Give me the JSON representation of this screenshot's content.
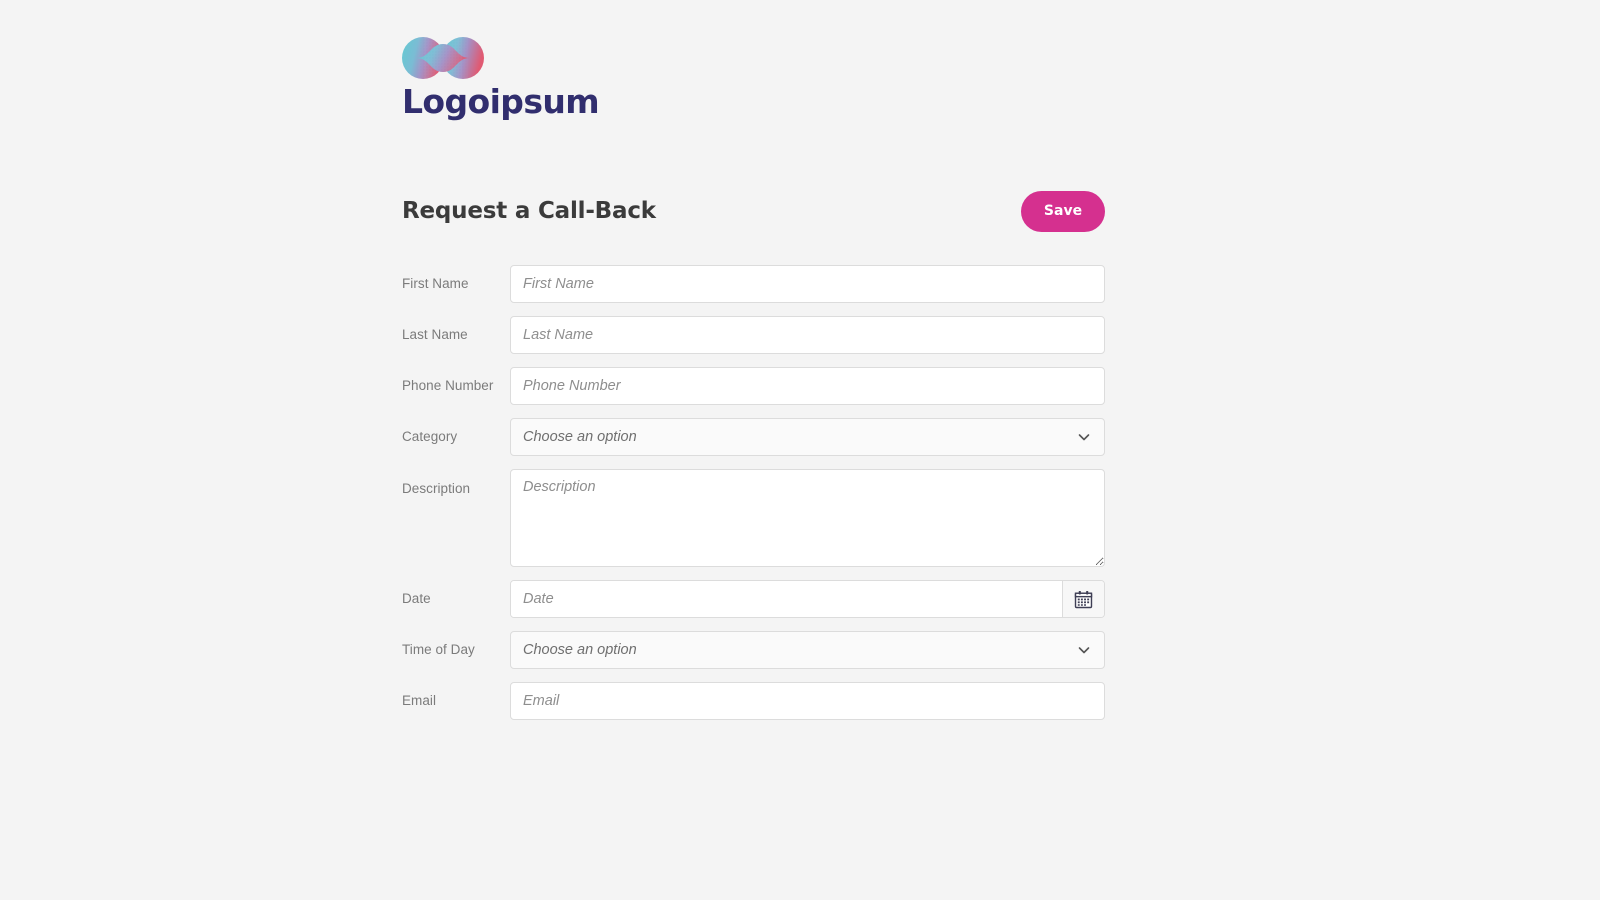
{
  "brand": {
    "wordmark": "Logoipsum",
    "mark_icon": "logo-dual-circle-gradient-icon",
    "colors": {
      "wordmark": "#312e6e",
      "mark_left": "#5bc8cf",
      "mark_right": "#e05a72",
      "mark_mid": "#9b8ec9"
    }
  },
  "header": {
    "title": "Request a Call-Back",
    "save_label": "Save",
    "accent_color": "#d5308f"
  },
  "form": {
    "fields": [
      {
        "id": "first-name",
        "label": "First Name",
        "type": "text",
        "placeholder": "First Name",
        "value": ""
      },
      {
        "id": "last-name",
        "label": "Last Name",
        "type": "text",
        "placeholder": "Last Name",
        "value": ""
      },
      {
        "id": "phone-number",
        "label": "Phone Number",
        "type": "text",
        "placeholder": "Phone Number",
        "value": ""
      },
      {
        "id": "category",
        "label": "Category",
        "type": "select",
        "placeholder": "Choose an option",
        "value": "Choose an option",
        "icon": "chevron-down-icon"
      },
      {
        "id": "description",
        "label": "Description",
        "type": "textarea",
        "placeholder": "Description",
        "value": ""
      },
      {
        "id": "date",
        "label": "Date",
        "type": "date",
        "placeholder": "Date",
        "value": "",
        "icon": "calendar-icon"
      },
      {
        "id": "time-of-day",
        "label": "Time of Day",
        "type": "select",
        "placeholder": "Choose an option",
        "value": "Choose an option",
        "icon": "chevron-down-icon"
      },
      {
        "id": "email",
        "label": "Email",
        "type": "text",
        "placeholder": "Email",
        "value": ""
      }
    ]
  }
}
